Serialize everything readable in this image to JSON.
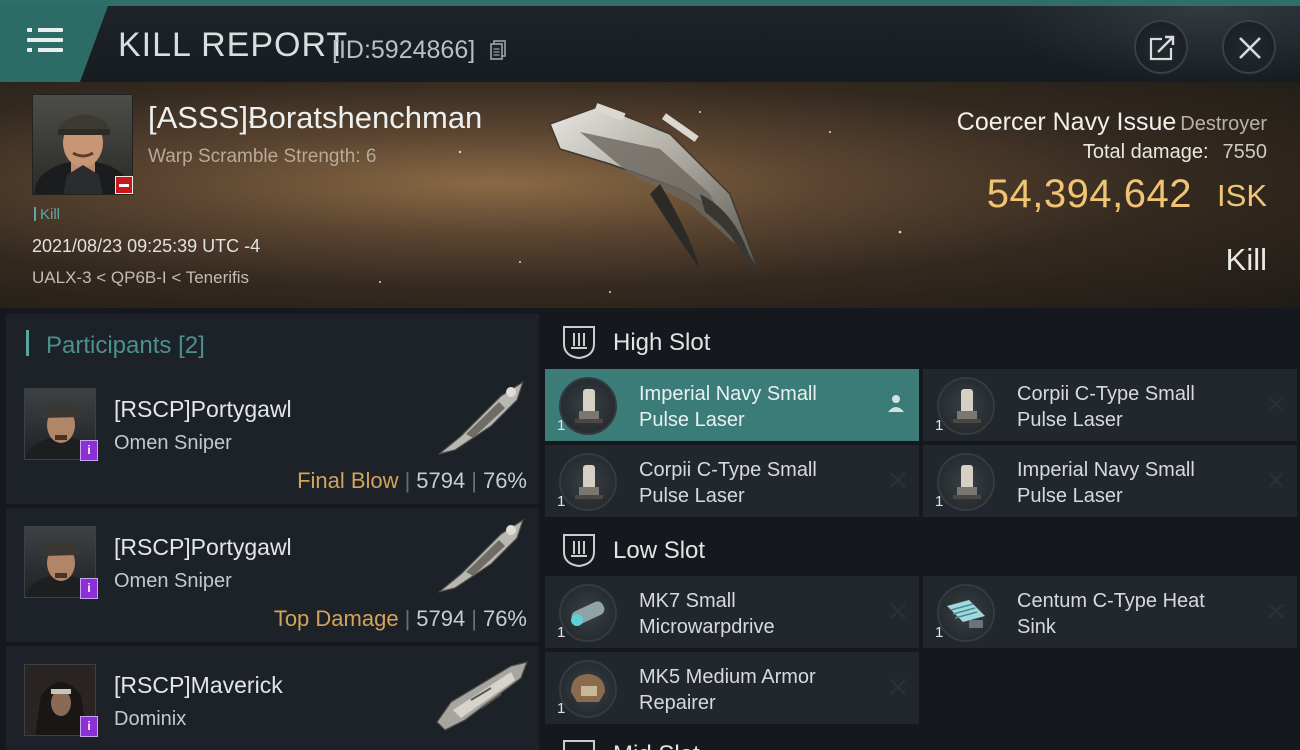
{
  "header": {
    "title": "KILL REPORT",
    "kill_id": "[ID:5924866]"
  },
  "victim": {
    "name": "[ASSS]Boratshenchman",
    "subtitle": "Warp Scramble Strength: 6",
    "tag": "Kill",
    "datetime": "2021/08/23 09:25:39 UTC -4",
    "location": "UALX-3 < QP6B-I < Tenerifis",
    "ship_name": "Coercer Navy Issue",
    "ship_class": "Destroyer",
    "total_damage_label": "Total damage:",
    "total_damage": "7550",
    "isk_value": "54,394,642",
    "isk_unit": "ISK",
    "result_label": "Kill"
  },
  "participants": {
    "title": "Participants",
    "count": "[2]",
    "rows": [
      {
        "name": "[RSCP]Portygawl",
        "ship": "Omen Sniper",
        "tag": "Final Blow",
        "damage": "5794",
        "percent": "76%",
        "badge": "i"
      },
      {
        "name": "[RSCP]Portygawl",
        "ship": "Omen Sniper",
        "tag": "Top Damage",
        "damage": "5794",
        "percent": "76%",
        "badge": "i"
      },
      {
        "name": "[RSCP]Maverick",
        "ship": "Dominix",
        "tag": "",
        "damage": "",
        "percent": "",
        "badge": "i"
      }
    ]
  },
  "fitting": {
    "high_slot_label": "High Slot",
    "low_slot_label": "Low Slot",
    "mid_slot_label": "Mid Slot",
    "high_modules": [
      {
        "name": "Imperial Navy Small Pulse Laser",
        "qty": "1"
      },
      {
        "name": "Corpii C-Type Small Pulse Laser",
        "qty": "1"
      },
      {
        "name": "Corpii C-Type Small Pulse Laser",
        "qty": "1"
      },
      {
        "name": "Imperial Navy Small Pulse Laser",
        "qty": "1"
      }
    ],
    "low_modules": [
      {
        "name": "MK7 Small Microwarpdrive",
        "qty": "1"
      },
      {
        "name": "Centum C-Type Heat Sink",
        "qty": "1"
      },
      {
        "name": "MK5 Medium Armor Repairer",
        "qty": "1"
      }
    ]
  },
  "colors": {
    "accent": "#2c6b66",
    "selected_module": "#3b7c79",
    "isk_gold": "#f0c474",
    "tag_orange": "#d4a35a",
    "badge_purple": "#8b2fd6",
    "security_red": "#c81818"
  }
}
